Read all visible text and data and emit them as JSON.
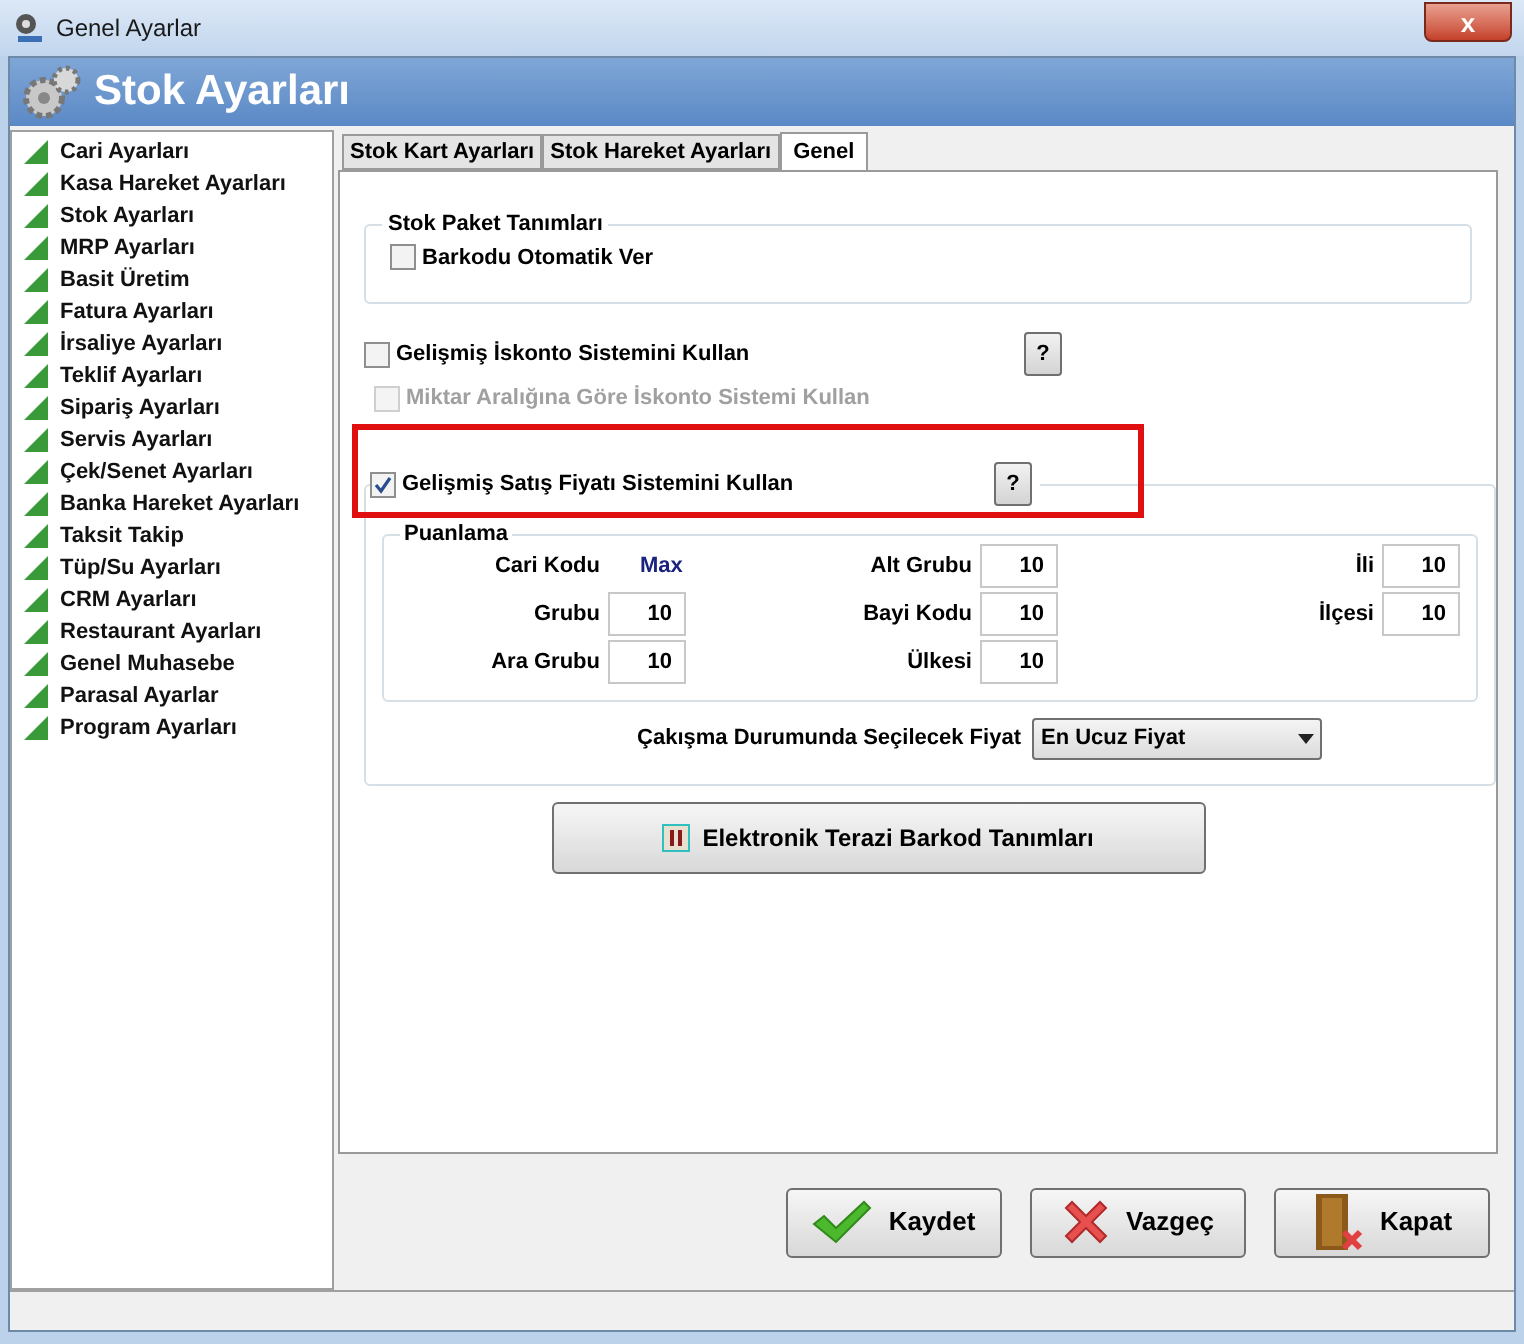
{
  "window": {
    "title": "Genel Ayarlar",
    "close": "x"
  },
  "header": {
    "title": "Stok Ayarları"
  },
  "sidebar": {
    "items": [
      {
        "label": "Cari Ayarları"
      },
      {
        "label": "Kasa Hareket Ayarları"
      },
      {
        "label": "Stok Ayarları"
      },
      {
        "label": "MRP Ayarları"
      },
      {
        "label": "Basit Üretim"
      },
      {
        "label": "Fatura Ayarları"
      },
      {
        "label": "İrsaliye Ayarları"
      },
      {
        "label": "Teklif Ayarları"
      },
      {
        "label": "Sipariş Ayarları"
      },
      {
        "label": "Servis Ayarları"
      },
      {
        "label": "Çek/Senet Ayarları"
      },
      {
        "label": "Banka Hareket Ayarları"
      },
      {
        "label": "Taksit Takip"
      },
      {
        "label": "Tüp/Su Ayarları"
      },
      {
        "label": "CRM Ayarları"
      },
      {
        "label": "Restaurant Ayarları"
      },
      {
        "label": "Genel Muhasebe"
      },
      {
        "label": "Parasal Ayarlar"
      },
      {
        "label": "Program Ayarları"
      }
    ]
  },
  "tabs": [
    {
      "label": "Stok Kart Ayarları",
      "selected": false
    },
    {
      "label": "Stok Hareket Ayarları",
      "selected": false
    },
    {
      "label": "Genel",
      "selected": true
    }
  ],
  "stock_package": {
    "title": "Stok Paket Tanımları",
    "option": {
      "label": "Barkodu Otomatik Ver",
      "checked": false
    }
  },
  "discount": {
    "label": "Gelişmiş İskonto Sistemini Kullan",
    "checked": false,
    "help": "?",
    "sub_option": {
      "label": "Miktar Aralığına Göre İskonto Sistemi Kullan",
      "checked": false,
      "disabled": true
    }
  },
  "sales_price": {
    "label": "Gelişmiş Satış Fiyatı Sistemini Kullan",
    "checked": true,
    "help": "?",
    "scoring": {
      "title": "Puanlama",
      "fields": [
        {
          "label": "Cari Kodu",
          "value": "Max",
          "kind": "text"
        },
        {
          "label": "Alt Grubu",
          "value": "10",
          "kind": "input"
        },
        {
          "label": "İli",
          "value": "10",
          "kind": "input"
        },
        {
          "label": "Grubu",
          "value": "10",
          "kind": "input"
        },
        {
          "label": "Bayi Kodu",
          "value": "10",
          "kind": "input"
        },
        {
          "label": "İlçesi",
          "value": "10",
          "kind": "input"
        },
        {
          "label": "Ara Grubu",
          "value": "10",
          "kind": "input"
        },
        {
          "label": "Ülkesi",
          "value": "10",
          "kind": "input"
        }
      ]
    },
    "conflict": {
      "label": "Çakışma Durumunda Seçilecek Fiyat",
      "value": "En Ucuz Fiyat"
    }
  },
  "scale_button": {
    "label": "Elektronik Terazi Barkod Tanımları"
  },
  "buttons": [
    {
      "label": "Kaydet",
      "kind": "save"
    },
    {
      "label": "Vazgeç",
      "kind": "cancel"
    },
    {
      "label": "Kapat",
      "kind": "close"
    }
  ]
}
